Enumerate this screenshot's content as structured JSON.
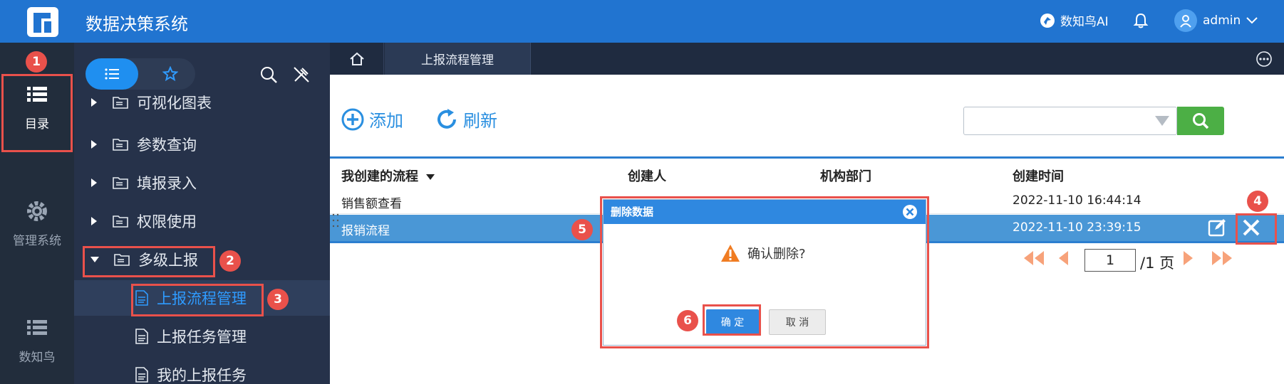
{
  "app": {
    "title": "数据决策系统",
    "ai_label": "数知鸟AI",
    "user_name": "admin"
  },
  "rail": {
    "items": [
      {
        "label": "目录",
        "icon": "list-icon"
      },
      {
        "label": "管理系统",
        "icon": "gear-icon"
      },
      {
        "label": "数知鸟",
        "icon": "list-icon"
      }
    ]
  },
  "sidebar": {
    "items": [
      {
        "label": "可视化图表",
        "type": "folder"
      },
      {
        "label": "参数查询",
        "type": "folder"
      },
      {
        "label": "填报录入",
        "type": "folder"
      },
      {
        "label": "权限使用",
        "type": "folder"
      },
      {
        "label": "多级上报",
        "type": "folder",
        "expanded": true
      },
      {
        "label": "上报流程管理",
        "type": "doc",
        "selected": true
      },
      {
        "label": "上报任务管理",
        "type": "doc"
      },
      {
        "label": "我的上报任务",
        "type": "doc"
      }
    ]
  },
  "tabs": {
    "active": "上报流程管理"
  },
  "toolbar": {
    "add_label": "添加",
    "refresh_label": "刷新"
  },
  "grid": {
    "headers": [
      "我创建的流程",
      "创建人",
      "机构部门",
      "创建时间"
    ],
    "rows": [
      {
        "name": "销售额查看",
        "time": "2022-11-10 16:44:14"
      },
      {
        "name": "报销流程",
        "time": "2022-11-10 23:39:15"
      }
    ]
  },
  "pager": {
    "current": "1",
    "total_label": "/1 页"
  },
  "dialog": {
    "title": "删除数据",
    "message": "确认删除?",
    "ok_label": "确 定",
    "cancel_label": "取 消"
  },
  "annotations": [
    "1",
    "2",
    "3",
    "4",
    "5",
    "6"
  ],
  "colors": {
    "topbar": "#2174d0",
    "accent": "#2f88e0",
    "annotation": "#e9514b",
    "selected_row": "#4a97d6"
  }
}
